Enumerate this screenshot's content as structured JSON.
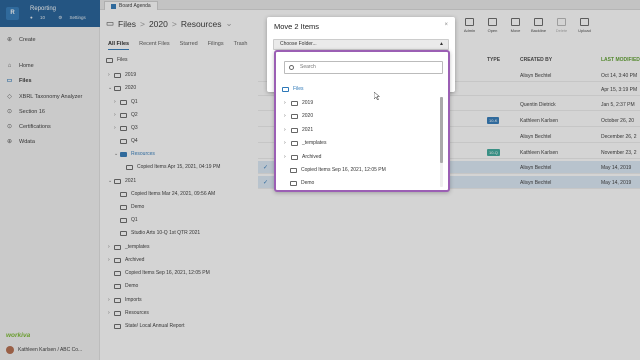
{
  "sidebar": {
    "workspace": "Reporting",
    "ws_icon": "R",
    "ws_count": "10",
    "ws_settings": "Settings",
    "items": [
      {
        "label": "Create"
      },
      {
        "label": "Home"
      },
      {
        "label": "Files"
      },
      {
        "label": "XBRL Taxonomy Analyzer"
      },
      {
        "label": "Section 16"
      },
      {
        "label": "Certifications"
      },
      {
        "label": "Wdata"
      }
    ],
    "brand": "workiva",
    "user": "Kathleen Karlsen / ABC Co..."
  },
  "topbar": {
    "tab": "Board Agenda"
  },
  "breadcrumb": [
    "Files",
    "2020",
    "Resources"
  ],
  "subtabs": [
    "All Files",
    "Recent Files",
    "Starred",
    "Filings",
    "Trash"
  ],
  "toolbar": [
    {
      "label": "Admin"
    },
    {
      "label": "Open"
    },
    {
      "label": "Move"
    },
    {
      "label": "Backline"
    },
    {
      "label": "Delete"
    },
    {
      "label": "Upload"
    }
  ],
  "columns": {
    "type": "TYPE",
    "created_by": "CREATED BY",
    "last_modified": "LAST MODIFIED"
  },
  "tree": {
    "root": "Files",
    "items": [
      {
        "label": "2019"
      },
      {
        "label": "2020"
      },
      {
        "label": "Q1"
      },
      {
        "label": "Q2"
      },
      {
        "label": "Q3"
      },
      {
        "label": "Q4"
      },
      {
        "label": "Resources"
      },
      {
        "label": "Copied Items Apr 15, 2021, 04:19 PM"
      },
      {
        "label": "2021"
      },
      {
        "label": "Copied Items Mar 24, 2021, 09:56 AM"
      },
      {
        "label": "Demo"
      },
      {
        "label": "Q1"
      },
      {
        "label": "Studio Arts 10-Q 1st QTR 2021"
      },
      {
        "label": "_templates"
      },
      {
        "label": "Archived"
      },
      {
        "label": "Copied Items Sep 16, 2021, 12:05 PM"
      },
      {
        "label": "Demo"
      },
      {
        "label": "Imports"
      },
      {
        "label": "Resources"
      },
      {
        "label": "State/ Local Annual Report"
      }
    ]
  },
  "rows": [
    {
      "by": "Alisyn Bechtel",
      "mod": "Oct 14, 3:40 PM",
      "badge": ""
    },
    {
      "by": "",
      "mod": "Apr 15, 3:19 PM",
      "badge": ""
    },
    {
      "by": "Quentin Dietrick",
      "mod": "Jan 5, 2:37 PM",
      "badge": ""
    },
    {
      "by": "Kathleen Karlsen",
      "mod": "October 26, 20",
      "badge": "10-K"
    },
    {
      "by": "Alisyn Bechtel",
      "mod": "December 26, 2",
      "badge": ""
    },
    {
      "by": "Kathleen Karlsen",
      "mod": "November 23, 2",
      "badge": "10-Q"
    },
    {
      "by": "Alisyn Bechtel",
      "mod": "May 14, 2019",
      "badge": ""
    },
    {
      "by": "Alisyn Bechtel",
      "mod": "May 14, 2019",
      "badge": ""
    }
  ],
  "modal": {
    "title": "Move 2 Items",
    "close": "×",
    "select_placeholder": "Choose Folder...",
    "search_placeholder": "Search",
    "root": "Files",
    "items": [
      {
        "label": "2019"
      },
      {
        "label": "2020"
      },
      {
        "label": "2021"
      },
      {
        "label": "_templates"
      },
      {
        "label": "Archived"
      },
      {
        "label": "Copied Items Sep 16, 2021, 12:05 PM"
      },
      {
        "label": "Demo"
      }
    ]
  },
  "colors": {
    "accent": "#2d78b8",
    "focus_border": "#9b5fb4",
    "brand": "#76b82a",
    "badge_10k": "#2d78b8",
    "badge_10q": "#3aa89a"
  }
}
